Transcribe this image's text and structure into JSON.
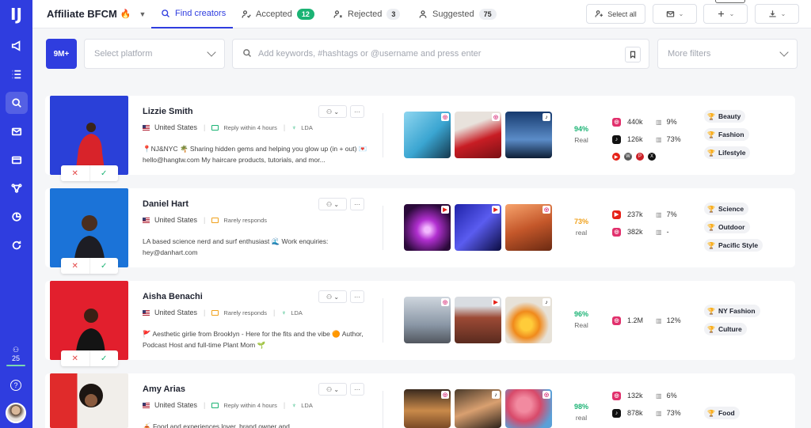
{
  "sidebar": {
    "logo": "IJ",
    "items": [
      {
        "name": "megaphone-icon"
      },
      {
        "name": "list-icon"
      },
      {
        "name": "search-icon"
      },
      {
        "name": "mail-icon"
      },
      {
        "name": "card-icon"
      },
      {
        "name": "network-icon"
      },
      {
        "name": "pie-icon"
      },
      {
        "name": "refresh-icon"
      }
    ],
    "count": "25",
    "help": "?"
  },
  "header": {
    "campaign": "Affiliate BFCM",
    "campaign_emoji": "🔥",
    "tabs": [
      {
        "label": "Find creators",
        "count": ""
      },
      {
        "label": "Accepted",
        "count": "12"
      },
      {
        "label": "Rejected",
        "count": "3"
      },
      {
        "label": "Suggested",
        "count": "75"
      }
    ],
    "select_all": "Select all"
  },
  "filters": {
    "followers_button": "9M+",
    "platform_placeholder": "Select platform",
    "search_placeholder": "Add keywords, #hashtags or @username and press enter",
    "more_filters": "More filters"
  },
  "creators": [
    {
      "name": "Lizzie Smith",
      "country": "United States",
      "reply": "Reply within 4 hours",
      "lda": "LDA",
      "bio": "📍NJ&NYC 🌴 Sharing hidden gems and helping you glow up (in + out) 💌 hello@hangtw.com My haircare products, tutorials, and mor...",
      "real_pct": "94%",
      "real_label": "Real",
      "stats": [
        {
          "platform": "instagram",
          "followers": "440k",
          "engagement": "9%"
        },
        {
          "platform": "tiktok",
          "followers": "126k",
          "engagement": "73%"
        }
      ],
      "tags": [
        "Beauty",
        "Fashion",
        "Lifestyle"
      ]
    },
    {
      "name": "Daniel Hart",
      "country": "United States",
      "reply": "Rarely responds",
      "lda": "",
      "bio": "LA based science nerd and surf enthusiast 🌊 Work enquiries: hey@danhart.com",
      "real_pct": "73%",
      "real_label": "real",
      "stats": [
        {
          "platform": "youtube",
          "followers": "237k",
          "engagement": "7%"
        },
        {
          "platform": "instagram",
          "followers": "382k",
          "engagement": "-"
        }
      ],
      "tags": [
        "Science",
        "Outdoor",
        "Pacific Style"
      ]
    },
    {
      "name": "Aisha Benachi",
      "country": "United States",
      "reply": "Rarely responds",
      "lda": "LDA",
      "bio": "🚩 Aesthetic girlie from Brooklyn - Here for the fits and the vibe 🟠 Author, Podcast Host and full-time Plant Mom 🌱",
      "real_pct": "96%",
      "real_label": "Real",
      "stats": [
        {
          "platform": "instagram",
          "followers": "1.2M",
          "engagement": "12%"
        }
      ],
      "tags": [
        "NY Fashion",
        "Culture"
      ]
    },
    {
      "name": "Amy Arias",
      "country": "United States",
      "reply": "Reply within 4 hours",
      "lda": "LDA",
      "bio": "🍝 Food and experiences lover, brand owner and",
      "real_pct": "98%",
      "real_label": "real",
      "stats": [
        {
          "platform": "instagram",
          "followers": "132k",
          "engagement": "6%"
        },
        {
          "platform": "tiktok",
          "followers": "878k",
          "engagement": "73%"
        }
      ],
      "tags": [
        "Food"
      ]
    }
  ],
  "colors": {
    "brand": "#2f3ddf",
    "green": "#1bb374",
    "orange": "#f0a11c"
  }
}
